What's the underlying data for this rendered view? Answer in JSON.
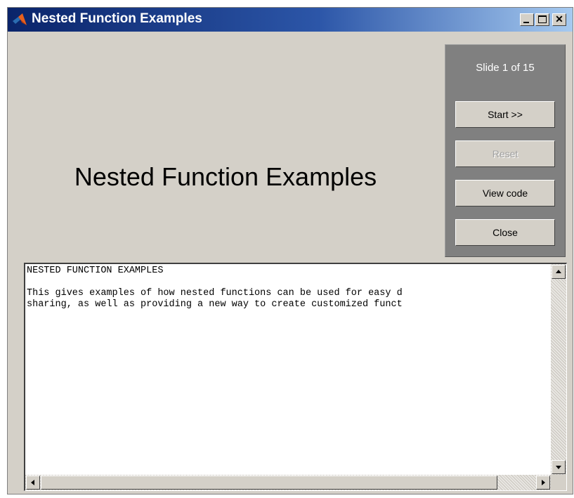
{
  "window": {
    "title": "Nested Function Examples",
    "icon": "matlab-logo-icon"
  },
  "slide": {
    "title": "Nested Function Examples"
  },
  "control_panel": {
    "counter": "Slide 1 of 15",
    "start_label": "Start >>",
    "reset_label": "Reset",
    "view_code_label": "View code",
    "close_label": "Close"
  },
  "text_area": {
    "heading": "NESTED FUNCTION EXAMPLES",
    "line1": "This gives examples of how nested functions can be used for easy d",
    "line2": "sharing, as well as providing a new way to create customized funct"
  },
  "colors": {
    "titlebar_start": "#0a246a",
    "titlebar_end": "#a6caf0",
    "window_bg": "#d4d0c8",
    "panel_bg": "#808080"
  }
}
